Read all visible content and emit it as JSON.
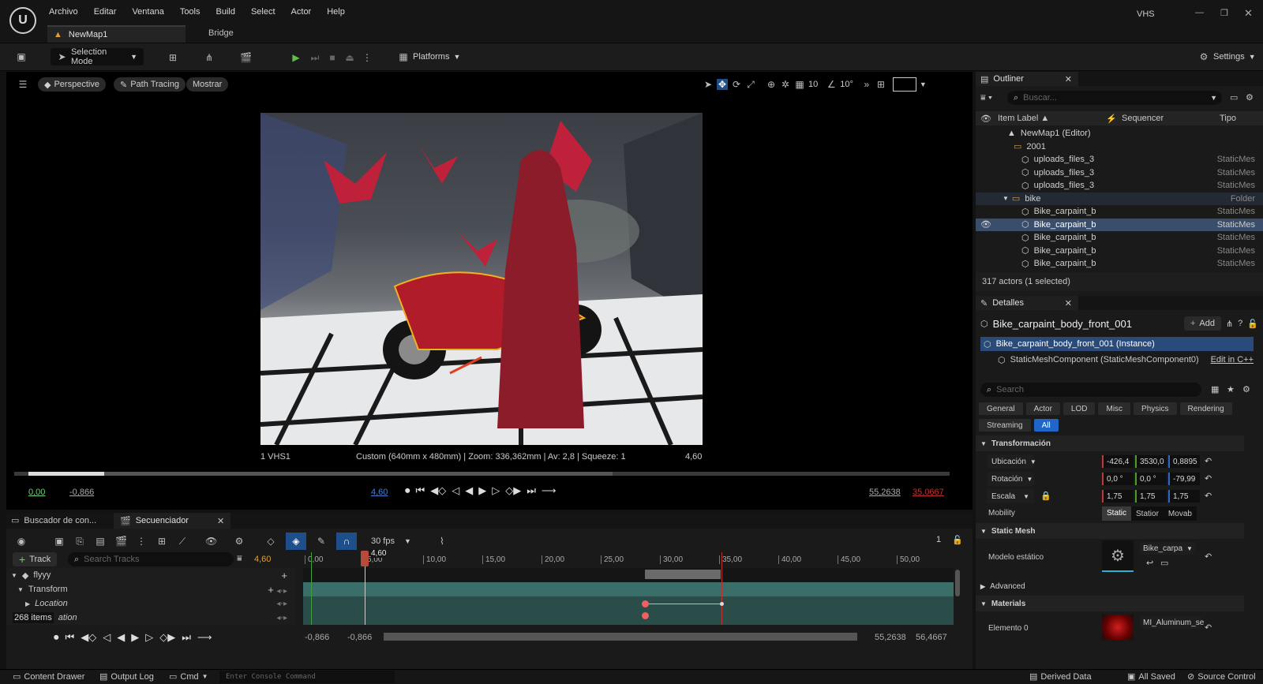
{
  "menu": {
    "items": [
      "Archivo",
      "Editar",
      "Ventana",
      "Tools",
      "Build",
      "Select",
      "Actor",
      "Help"
    ],
    "project": "VHS"
  },
  "tabs": {
    "level": "NewMap1",
    "bridge": "Bridge"
  },
  "toolbar": {
    "selection_mode": "Selection Mode",
    "platforms": "Platforms",
    "settings": "Settings"
  },
  "viewport": {
    "perspective": "Perspective",
    "path_tracing": "Path Tracing",
    "show": "Mostrar",
    "grid_value": "10",
    "angle_value": "10°",
    "camera_name": "1 VHS1",
    "camera_info": "Custom (640mm x 480mm) | Zoom: 336,362mm | Av: 2,8 | Squeeze: 1",
    "frame": "4,60",
    "play_start": "0,00",
    "play_in": "-0,866",
    "play_current": "4,60",
    "play_out": "55,2638",
    "play_end": "35,0667"
  },
  "sequencer": {
    "tab_content": "Buscador de con...",
    "tab_seq": "Secuenciador",
    "fps": "30 fps",
    "page": "1",
    "track_btn": "Track",
    "search_placeholder": "Search Tracks",
    "current_time": "4,60",
    "playhead_label": "4,60",
    "ticks": [
      "0,00",
      "5,00",
      "10,00",
      "15,00",
      "20,00",
      "25,00",
      "30,00",
      "35,00",
      "40,00",
      "45,00",
      "50,00"
    ],
    "tracks": {
      "root": "flyyy",
      "transform": "Transform",
      "location": "Location",
      "rotation": "ation"
    },
    "items_count": "268 items",
    "range_a": "-0,866",
    "range_b": "-0,866",
    "range_c": "55,2638",
    "range_d": "56,4667"
  },
  "outliner": {
    "title": "Outliner",
    "search_placeholder": "Buscar...",
    "col_label": "Item Label ▲",
    "col_seq": "Sequencer",
    "col_type": "Tipo",
    "rows": [
      {
        "label": "NewMap1 (Editor)",
        "type": "",
        "indent": 1,
        "kind": "map"
      },
      {
        "label": "2001",
        "type": "",
        "indent": 2,
        "kind": "folder"
      },
      {
        "label": "uploads_files_3",
        "type": "StaticMes",
        "indent": 3,
        "kind": "mesh"
      },
      {
        "label": "uploads_files_3",
        "type": "StaticMes",
        "indent": 3,
        "kind": "mesh"
      },
      {
        "label": "uploads_files_3",
        "type": "StaticMes",
        "indent": 3,
        "kind": "mesh"
      },
      {
        "label": "bike",
        "type": "Folder",
        "indent": 2,
        "kind": "folder"
      },
      {
        "label": "Bike_carpaint_b",
        "type": "StaticMes",
        "indent": 3,
        "kind": "mesh"
      },
      {
        "label": "Bike_carpaint_b",
        "type": "StaticMes",
        "indent": 3,
        "kind": "mesh",
        "selected": true
      },
      {
        "label": "Bike_carpaint_b",
        "type": "StaticMes",
        "indent": 3,
        "kind": "mesh"
      },
      {
        "label": "Bike_carpaint_b",
        "type": "StaticMes",
        "indent": 3,
        "kind": "mesh"
      },
      {
        "label": "Bike_carpaint_b",
        "type": "StaticMes",
        "indent": 3,
        "kind": "mesh"
      }
    ],
    "footer": "317 actors (1 selected)"
  },
  "details": {
    "title": "Detalles",
    "object_name": "Bike_carpaint_body_front_001",
    "add": "Add",
    "instance": "Bike_carpaint_body_front_001 (Instance)",
    "component": "StaticMeshComponent (StaticMeshComponent0)",
    "edit_cpp": "Edit in C++",
    "search_placeholder": "Search",
    "filters": [
      "General",
      "Actor",
      "LOD",
      "Misc",
      "Physics",
      "Rendering"
    ],
    "filters2": [
      "Streaming",
      "All"
    ],
    "transform_hdr": "Transformación",
    "location": {
      "label": "Ubicación",
      "x": "-426,4",
      "y": "3530,0",
      "z": "0,8895"
    },
    "rotation": {
      "label": "Rotación",
      "x": "0,0 °",
      "y": "0,0 °",
      "z": "-79,99"
    },
    "scale": {
      "label": "Escala",
      "x": "1,75",
      "y": "1,75",
      "z": "1,75"
    },
    "mobility": {
      "label": "Mobility",
      "options": [
        "Static",
        "Statior",
        "Movab"
      ]
    },
    "static_mesh_hdr": "Static Mesh",
    "mesh_label": "Modelo estático",
    "mesh_value": "Bike_carpa",
    "advanced": "Advanced",
    "materials_hdr": "Materials",
    "element0": "Elemento 0",
    "material_value": "MI_Aluminum_se"
  },
  "status": {
    "content_drawer": "Content Drawer",
    "output_log": "Output Log",
    "cmd": "Cmd",
    "console_placeholder": "Enter Console Command",
    "derived": "Derived Data",
    "saved": "All Saved",
    "source": "Source Control"
  }
}
